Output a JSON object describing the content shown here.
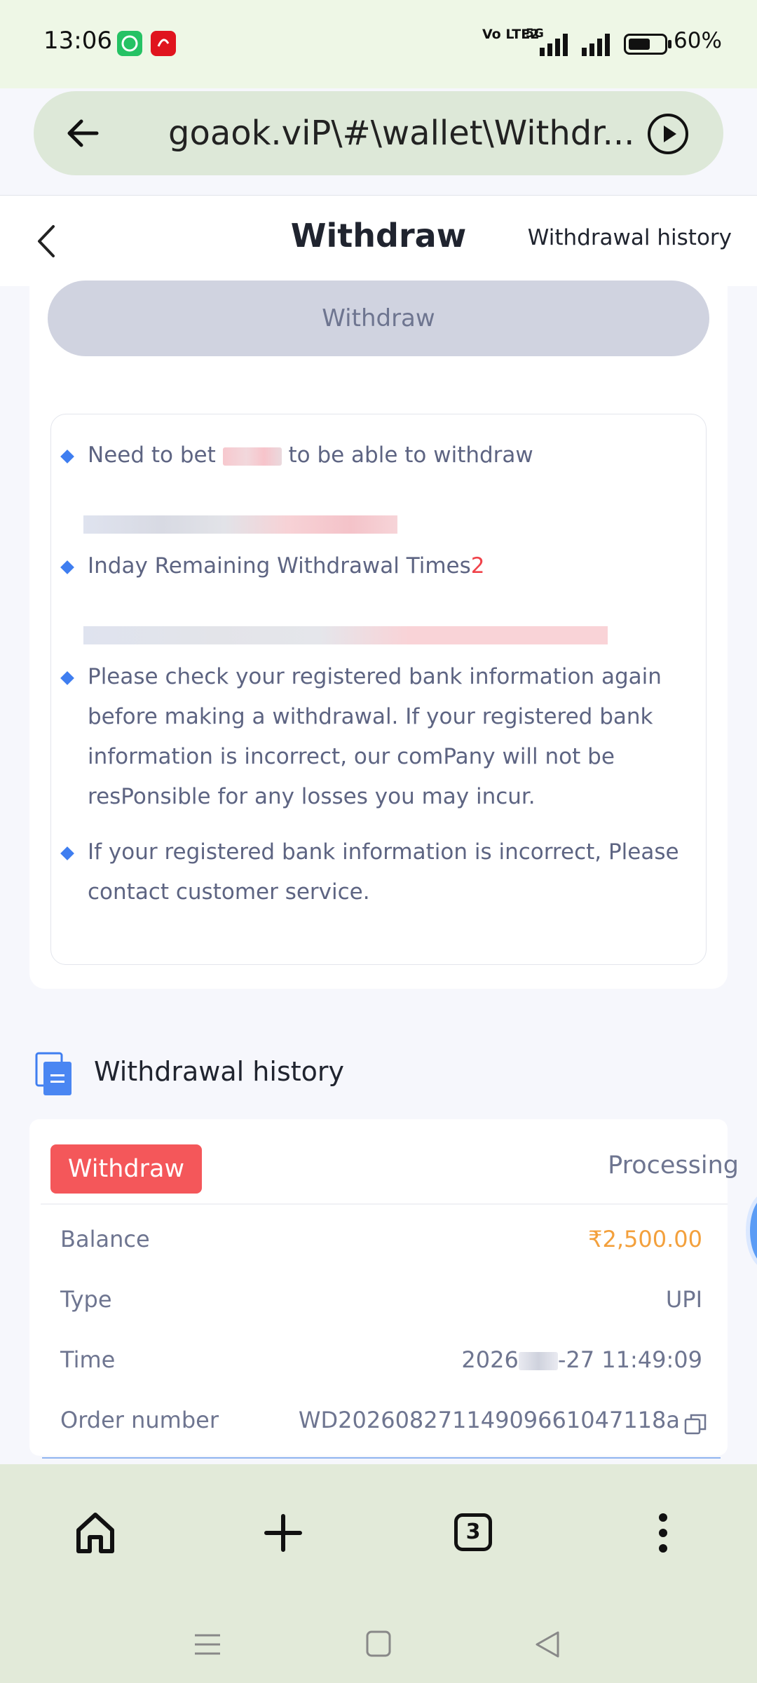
{
  "status_bar": {
    "time": "13:06",
    "apps": [
      "whatsapp-icon",
      "airtel-icon"
    ],
    "network_volte": "Vo LTE2",
    "network_5g": "5G",
    "battery": "60%"
  },
  "browser": {
    "url": "goaok.viP\\#\\wallet\\Withdr...",
    "tab_count": "3"
  },
  "header": {
    "title": "Withdraw",
    "history_link": "Withdrawal history"
  },
  "withdraw_button": "Withdraw",
  "notices": {
    "bet_prefix": "Need to bet",
    "bet_suffix": "to be able to withdraw",
    "remaining_label": "Inday Remaining Withdrawal Times",
    "remaining_value": "2",
    "check_bank": "Please check your registered bank information again before making a withdrawal. If your registered bank information is incorrect, our comPany will not be resPonsible for any losses you may incur.",
    "contact": "If your registered bank information is incorrect, Please contact customer service."
  },
  "history": {
    "section_title": "Withdrawal history",
    "record": {
      "tag": "Withdraw",
      "status": "Processing",
      "rows": [
        {
          "label": "Balance",
          "value": "₹2,500.00"
        },
        {
          "label": "Type",
          "value": "UPI"
        },
        {
          "label": "Time",
          "value_prefix": "2026",
          "value_suffix": "-27 11:49:09"
        },
        {
          "label": "Order number",
          "value": "WD202608271149096610471​18a"
        }
      ]
    }
  },
  "colors": {
    "accent_blue": "#3f7ef0",
    "tag_red": "#f4575a",
    "amount_orange": "#f3a03c",
    "text_muted": "#6e7590"
  }
}
